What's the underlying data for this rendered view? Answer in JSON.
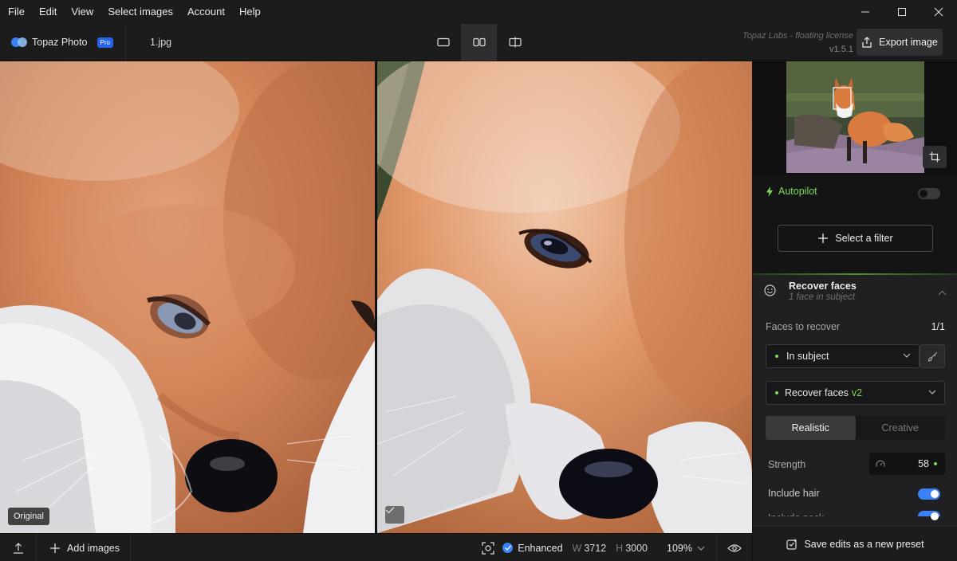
{
  "menu": [
    "File",
    "Edit",
    "View",
    "Select images",
    "Account",
    "Help"
  ],
  "toolbar": {
    "brand_name": "Topaz Photo",
    "pro_badge": "Pro",
    "filename": "1.jpg",
    "license_text": "Topaz Labs - floating license",
    "version": "v1.5.1",
    "export_label": "Export image"
  },
  "viewer": {
    "left_label": "Original"
  },
  "bottombar": {
    "add_images": "Add images",
    "status": "Enhanced",
    "width_label": "W",
    "width_value": "3712",
    "height_label": "H",
    "height_value": "3000",
    "zoom": "109%"
  },
  "panel": {
    "autopilot_label": "Autopilot",
    "autopilot_on": false,
    "select_filter": "Select a filter",
    "section_title": "Recover faces",
    "section_subtitle": "1 face in subject",
    "faces_label": "Faces to recover",
    "faces_value": "1/1",
    "subject_dropdown": "In subject",
    "model_dropdown": "Recover faces",
    "model_version": "v2",
    "modes": [
      "Realistic",
      "Creative"
    ],
    "active_mode": "Realistic",
    "strength_label": "Strength",
    "strength_value": "58",
    "include_hair_label": "Include hair",
    "include_hair_on": true,
    "include_neck_label": "Include neck",
    "include_neck_on": true,
    "save_preset": "Save edits as a new preset"
  },
  "colors": {
    "accent": "#3b82f6",
    "green": "#7ed957",
    "background": "#1c1c1d"
  }
}
